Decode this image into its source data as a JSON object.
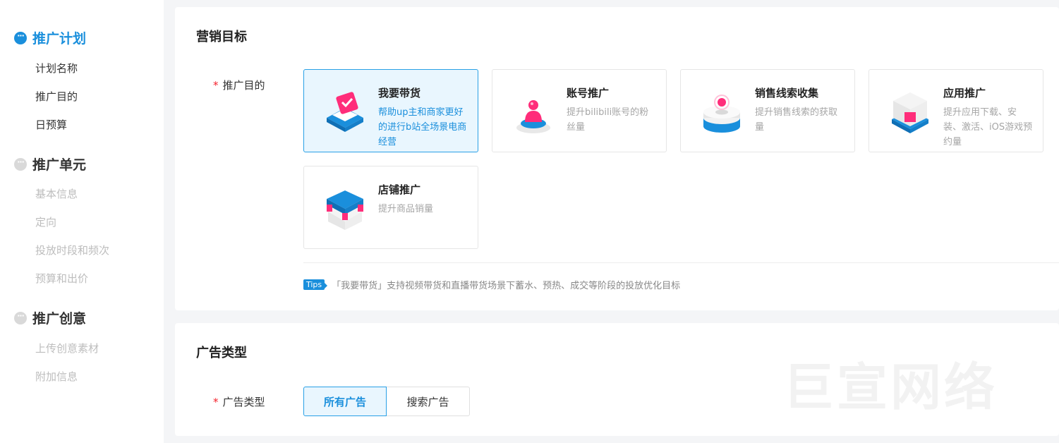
{
  "sidebar": {
    "sections": [
      {
        "title": "推广计划",
        "active": true,
        "items": [
          "计划名称",
          "推广目的",
          "日预算"
        ]
      },
      {
        "title": "推广单元",
        "active": false,
        "items": [
          "基本信息",
          "定向",
          "投放时段和频次",
          "预算和出价"
        ]
      },
      {
        "title": "推广创意",
        "active": false,
        "items": [
          "上传创意素材",
          "附加信息"
        ]
      }
    ]
  },
  "marketing": {
    "title": "营销目标",
    "field_label": "推广目的",
    "options": [
      {
        "name": "我要带货",
        "desc": "帮助up主和商家更好的进行b站全场景电商经营",
        "icon": "shopping-bag-icon",
        "selected": true
      },
      {
        "name": "账号推广",
        "desc": "提升bilibili账号的粉丝量",
        "icon": "account-person-icon",
        "selected": false
      },
      {
        "name": "销售线索收集",
        "desc": "提升销售线索的获取量",
        "icon": "lead-collection-icon",
        "selected": false
      },
      {
        "name": "应用推广",
        "desc": "提升应用下载、安装、激活、iOS游戏预约量",
        "icon": "app-box-icon",
        "selected": false
      },
      {
        "name": "店铺推广",
        "desc": "提升商品销量",
        "icon": "store-icon",
        "selected": false
      }
    ],
    "tips_badge": "Tips",
    "tips_text": "「我要带货」支持视频带货和直播带货场景下蓄水、预热、成交等阶段的投放优化目标"
  },
  "ad_type": {
    "title": "广告类型",
    "field_label": "广告类型",
    "options": [
      "所有广告",
      "搜索广告"
    ],
    "selected": "所有广告"
  },
  "watermark": "巨宣网络",
  "colors": {
    "accent": "#1a8fdc",
    "selected_bg": "#e9f6fe",
    "required": "#f5222d",
    "icon_pink": "#ff2d7a"
  }
}
